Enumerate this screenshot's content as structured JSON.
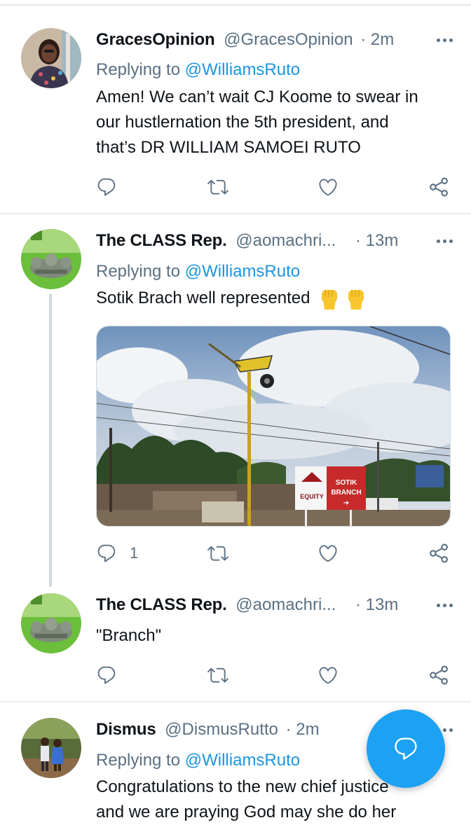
{
  "replying_to_prefix": "Replying to ",
  "tweets": [
    {
      "name": "GracesOpinion",
      "handle": "@GracesOpinion",
      "time": "· 2m",
      "reply_to": "@WilliamsRuto",
      "lines": [
        "Amen! We can’t wait CJ Koome to swear in",
        "our hustlernation the 5th president, and",
        "that’s DR WILLIAM SAMOEI RUTO"
      ]
    },
    {
      "name": "The CLASS Rep.",
      "handle": "@aomachri...",
      "time": "· 13m",
      "reply_to": "@WilliamsRuto",
      "text": "Sotik Brach well represented",
      "reply_count": "1",
      "media": {
        "sign_brand": "EQUITY",
        "sign_text_1": "SOTIK",
        "sign_text_2": "BRANCH",
        "sign_arrow": "➔"
      }
    },
    {
      "name": "The CLASS Rep.",
      "handle": "@aomachri...",
      "time": "· 13m",
      "text": "\"Branch\""
    },
    {
      "name": "Dismus",
      "handle": "@DismusRutto",
      "time": "· 2m",
      "reply_to": "@WilliamsRuto",
      "lines": [
        "Congratulations to the new chief justice",
        "and we are praying God may she do her"
      ]
    }
  ],
  "colors": {
    "accent": "#1da1f2",
    "link": "#1b95e0",
    "secondary": "#5b7083",
    "primary_text": "#0f1419"
  },
  "icons": [
    "reply-icon",
    "retweet-icon",
    "like-icon",
    "share-icon",
    "more-icon",
    "compose-reply-icon",
    "raised-fist-emoji"
  ]
}
